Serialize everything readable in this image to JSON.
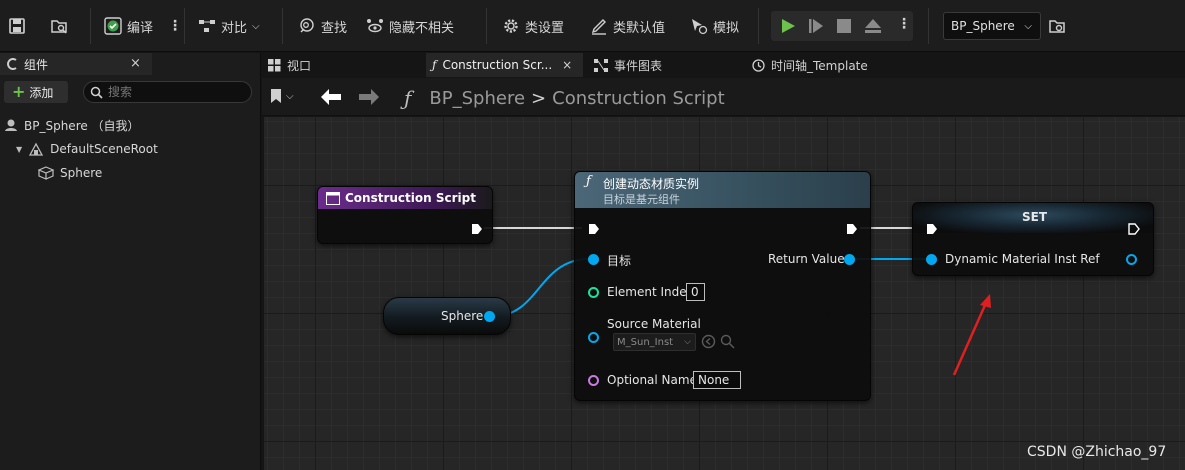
{
  "toolbar": {
    "compile": "编译",
    "diff": "对比",
    "find": "查找",
    "hide_unrelated": "隐藏不相关",
    "class_settings": "类设置",
    "class_defaults": "类默认值",
    "simulate": "模拟",
    "blueprint_select": "BP_Sphere"
  },
  "components_panel": {
    "tab_label": "组件",
    "close": "×",
    "add_label": "添加",
    "search_placeholder": "搜索",
    "tree": [
      {
        "label": "BP_Sphere （自我）"
      },
      {
        "label": "DefaultSceneRoot"
      },
      {
        "label": "Sphere"
      }
    ]
  },
  "editor_tabs": [
    {
      "label": "视口"
    },
    {
      "label": "Construction Scr...",
      "close": "×"
    },
    {
      "label": "事件图表"
    },
    {
      "label": "时间轴_Template"
    }
  ],
  "breadcrumb": {
    "root": "BP_Sphere",
    "separator": ">",
    "current": "Construction Script"
  },
  "graph": {
    "construction_node": {
      "title": "Construction Script"
    },
    "sphere_node": {
      "label": "Sphere"
    },
    "create_node": {
      "title": "创建动态材质实例",
      "subtitle": "目标是基元组件",
      "pin_target": "目标",
      "pin_element_index": "Element Index",
      "element_index_value": "0",
      "pin_source_material": "Source Material",
      "source_material_value": "M_Sun_Inst",
      "pin_optional_name": "Optional Name",
      "optional_name_value": "None",
      "pin_return_value": "Return Value"
    },
    "set_node": {
      "title": "SET",
      "pin_label": "Dynamic Material Inst Ref"
    }
  },
  "watermark": "CSDN @Zhichao_97",
  "colors": {
    "object_pin": "#00a8f0",
    "int_pin": "#1fe0a0",
    "name_pin": "#c87ce0",
    "construction_header": "#6b2c8c",
    "function_header": "#4b6778",
    "annotation_arrow": "#e02020",
    "play_green": "#6cc24a"
  }
}
